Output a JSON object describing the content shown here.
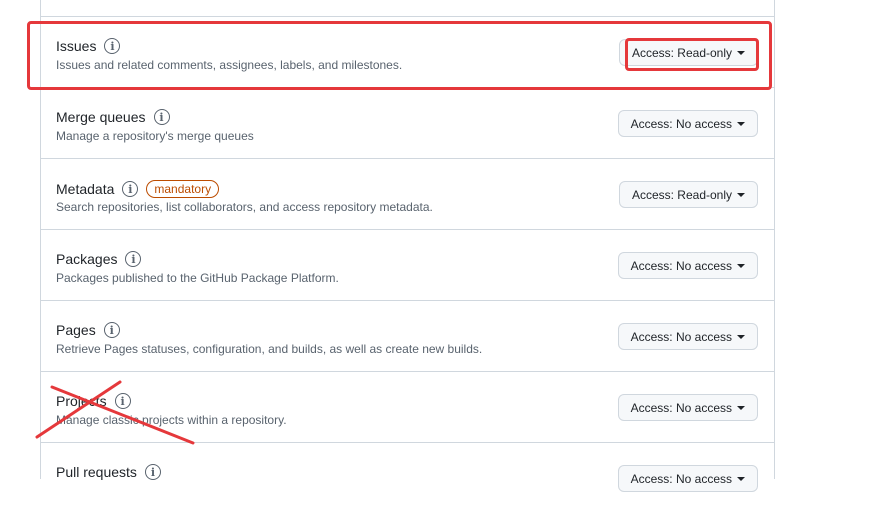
{
  "permissions": [
    {
      "title": "Issues",
      "description": "Issues and related comments, assignees, labels, and milestones.",
      "access": "Access: Read-only"
    },
    {
      "title": "Merge queues",
      "description": "Manage a repository's merge queues",
      "access": "Access: No access"
    },
    {
      "title": "Metadata",
      "badge": "mandatory",
      "description": "Search repositories, list collaborators, and access repository metadata.",
      "access": "Access: Read-only"
    },
    {
      "title": "Packages",
      "description": "Packages published to the GitHub Package Platform.",
      "access": "Access: No access"
    },
    {
      "title": "Pages",
      "description": "Retrieve Pages statuses, configuration, and builds, as well as create new builds.",
      "access": "Access: No access"
    },
    {
      "title": "Projects",
      "description": "Manage classic projects within a repository.",
      "access": "Access: No access"
    },
    {
      "title": "Pull requests",
      "access": "Access: No access"
    }
  ]
}
